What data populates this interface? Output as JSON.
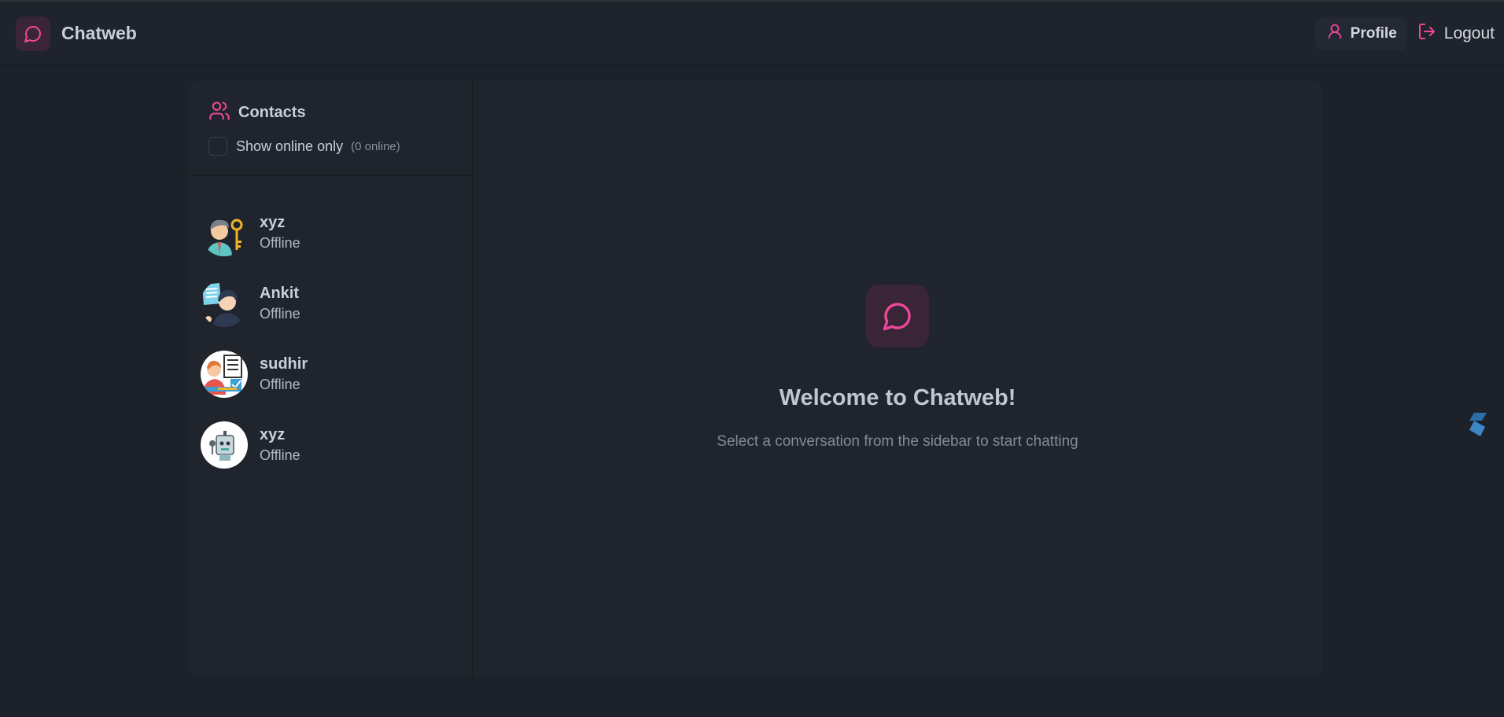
{
  "app": {
    "brand_name": "Chatweb",
    "accent_color": "#ec4899"
  },
  "nav": {
    "profile_label": "Profile",
    "logout_label": "Logout"
  },
  "sidebar": {
    "title": "Contacts",
    "online_filter_label": "Show online only",
    "online_count": "(0 online)",
    "contacts": [
      {
        "name": "xyz",
        "status": "Offline",
        "avatar": "businessman-with-key-avatar"
      },
      {
        "name": "Ankit",
        "status": "Offline",
        "avatar": "man-with-document-avatar"
      },
      {
        "name": "sudhir",
        "status": "Offline",
        "avatar": "person-with-checklist-avatar"
      },
      {
        "name": "xyz",
        "status": "Offline",
        "avatar": "robot-avatar"
      }
    ]
  },
  "welcome": {
    "title": "Welcome to Chatweb!",
    "subtitle": "Select a conversation from the sidebar to start chatting"
  }
}
